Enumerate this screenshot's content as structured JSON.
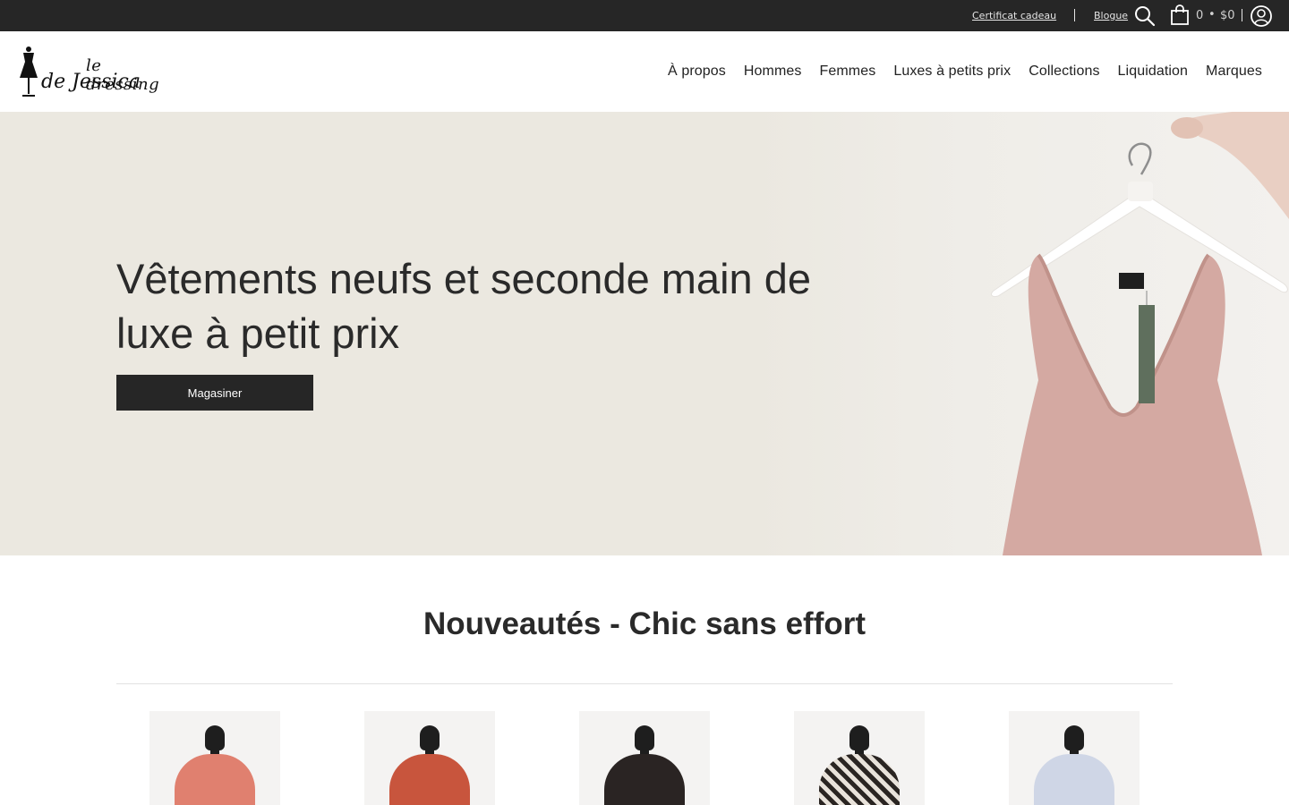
{
  "topbar": {
    "gift_certificate": "Certificat cadeau",
    "blog": "Blogue",
    "cart_count": "0",
    "cart_separator": "•",
    "cart_total": "$0"
  },
  "logo": {
    "line1": "le dressing",
    "line2": "de Jessica"
  },
  "nav": {
    "items": [
      "À propos",
      "Hommes",
      "Femmes",
      "Luxes à petits prix",
      "Collections",
      "Liquidation",
      "Marques"
    ]
  },
  "hero": {
    "title": "Vêtements neufs et seconde main de luxe à petit prix",
    "button": "Magasiner"
  },
  "section": {
    "title": "Nouveautés - Chic sans effort"
  },
  "products": [
    {
      "color": "#e0806f"
    },
    {
      "color": "#c8553d"
    },
    {
      "color": "#2a2423"
    },
    {
      "color": "#8a8078"
    },
    {
      "color": "#cfd6e6"
    }
  ],
  "colors": {
    "topbar_bg": "#262626",
    "hero_bg": "#ebe8e0",
    "button_bg": "#262626",
    "garment": "#d4a9a2"
  }
}
